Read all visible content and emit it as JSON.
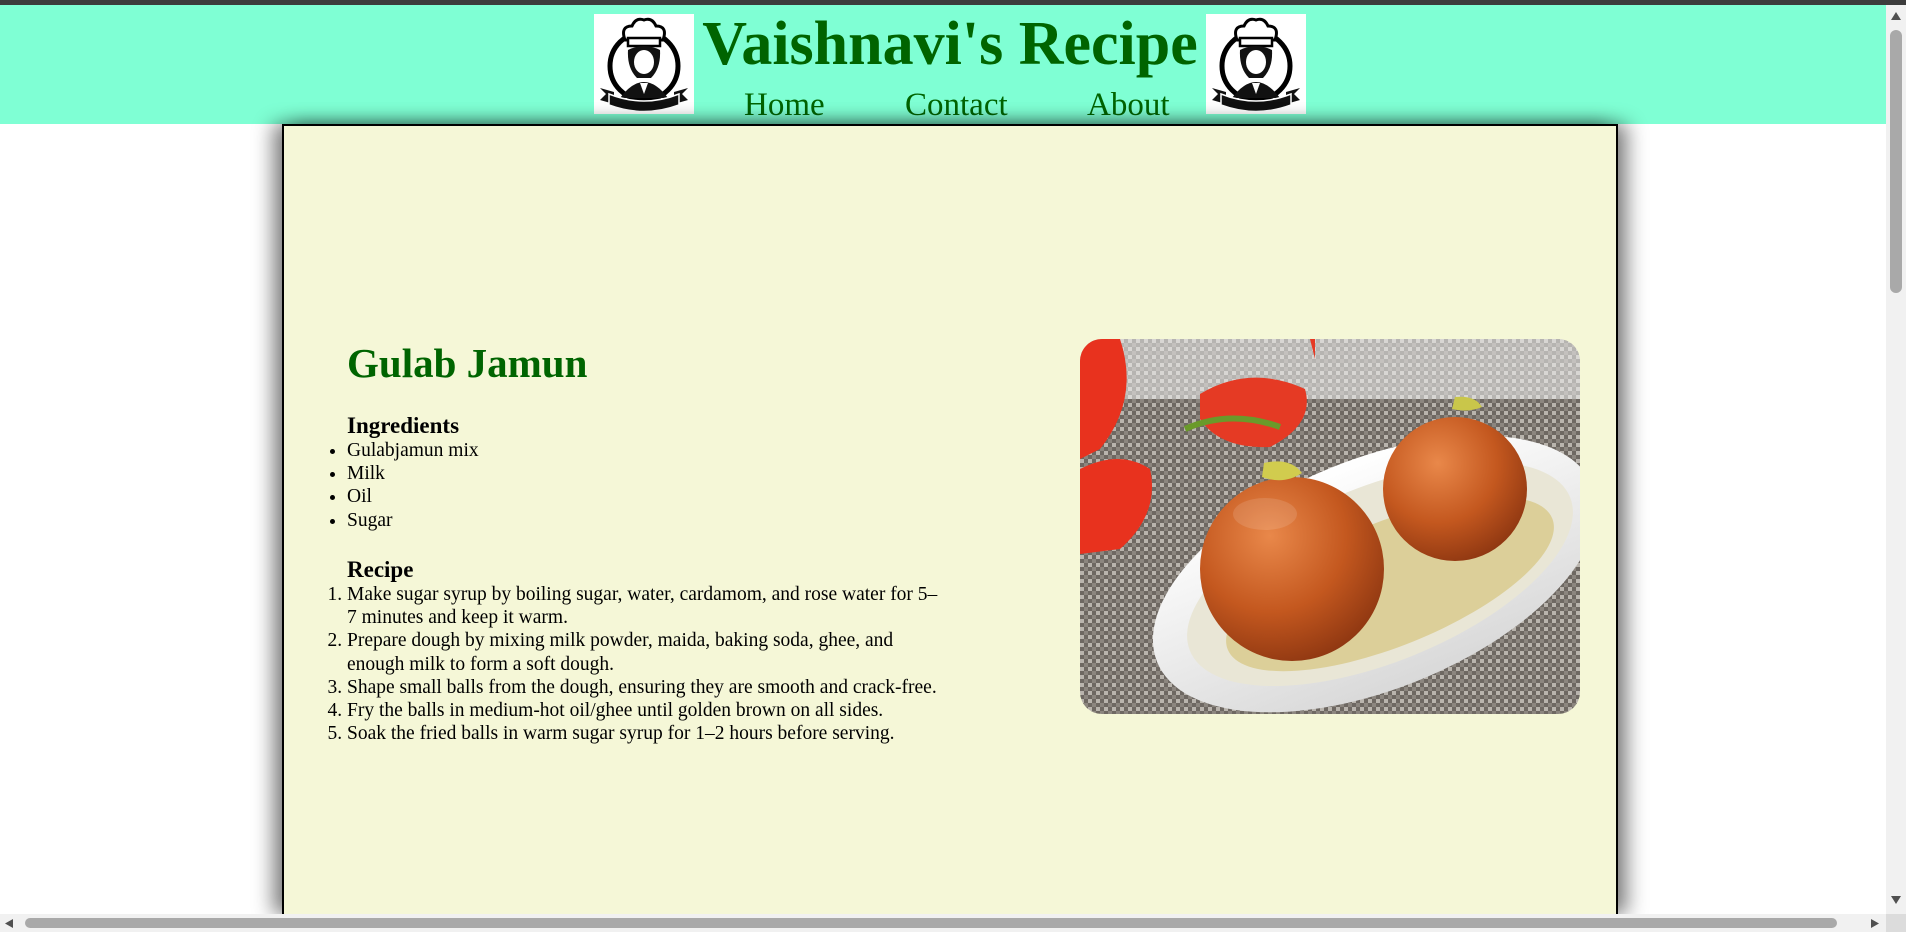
{
  "header": {
    "title": "Vaishnavi's Recipe",
    "nav": [
      "Home",
      "Contact",
      "About"
    ],
    "bg_color": "#7fffd4",
    "title_color": "#006400"
  },
  "recipe": {
    "name": "Gulab Jamun",
    "ingredients_heading": "Ingredients",
    "ingredients": [
      "Gulabjamun mix",
      "Milk",
      "Oil",
      "Sugar"
    ],
    "steps_heading": "Recipe",
    "steps": [
      "Make sugar syrup by boiling sugar, water, cardamom, and rose water for 5–7 minutes and keep it warm.",
      "Prepare dough by mixing milk powder, maida, baking soda, ghee, and enough milk to form a soft dough.",
      "Shape small balls from the dough, ensuring they are smooth and crack-free.",
      "Fry the balls in medium-hot oil/ghee until golden brown on all sides.",
      "Soak the fried balls in warm sugar syrup for 1–2 hours before serving."
    ],
    "card_bg": "#f5f7d7"
  },
  "icons": {
    "logo": "chef-logo-icon"
  }
}
